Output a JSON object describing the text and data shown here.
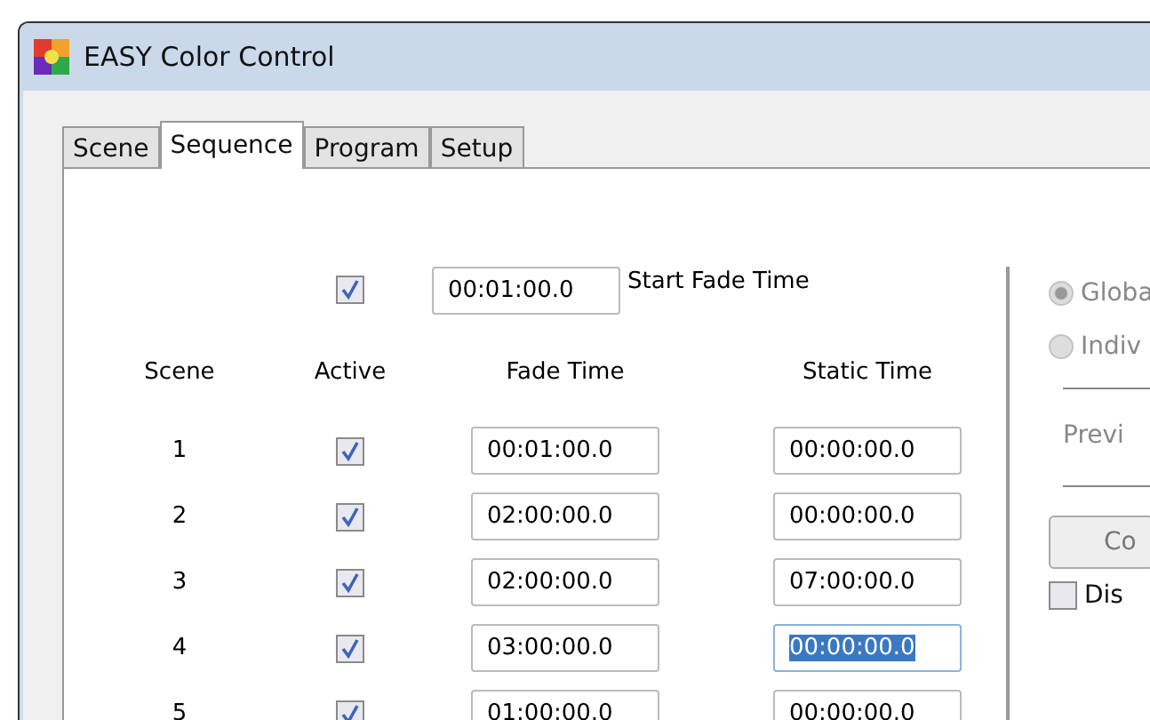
{
  "window": {
    "title": "EASY Color Control"
  },
  "tabs": [
    {
      "label": "Scene",
      "selected": false
    },
    {
      "label": "Sequence",
      "selected": true
    },
    {
      "label": "Program",
      "selected": false
    },
    {
      "label": "Setup",
      "selected": false
    }
  ],
  "start_fade": {
    "checked": true,
    "value": "00:01:00.0",
    "label": "Start Fade Time"
  },
  "columns": [
    "Scene",
    "Active",
    "Fade Time",
    "Static Time"
  ],
  "rows": [
    {
      "scene": "1",
      "active": true,
      "fade_time": "00:01:00.0",
      "static_time": "00:00:00.0",
      "static_selected": false
    },
    {
      "scene": "2",
      "active": true,
      "fade_time": "02:00:00.0",
      "static_time": "00:00:00.0",
      "static_selected": false
    },
    {
      "scene": "3",
      "active": true,
      "fade_time": "02:00:00.0",
      "static_time": "07:00:00.0",
      "static_selected": false
    },
    {
      "scene": "4",
      "active": true,
      "fade_time": "03:00:00.0",
      "static_time": "00:00:00.0",
      "static_selected": true
    },
    {
      "scene": "5",
      "active": true,
      "fade_time": "01:00:00.0",
      "static_time": "00:00:00.0",
      "static_selected": false
    }
  ],
  "side": {
    "radios": [
      {
        "label": "Globa",
        "selected": true
      },
      {
        "label": "Indiv",
        "selected": false
      }
    ],
    "preview": "Previ",
    "button": "Co",
    "checkbox": {
      "label": "Dis",
      "checked": false
    }
  }
}
